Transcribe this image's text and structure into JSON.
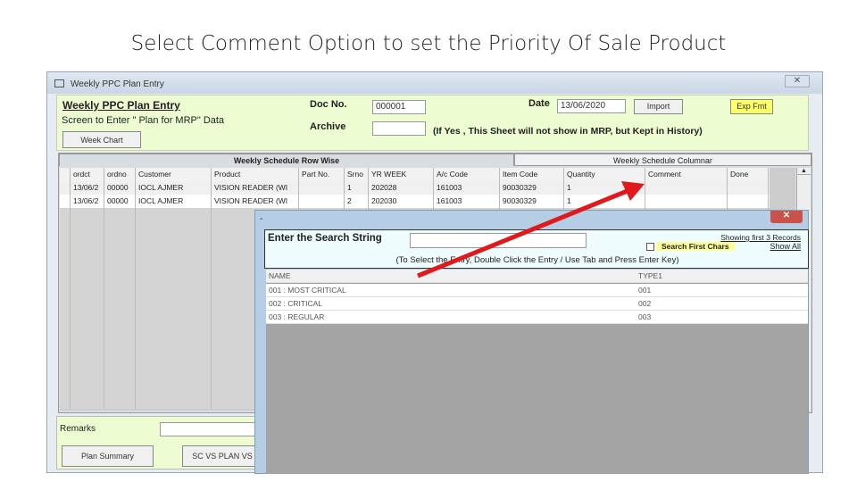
{
  "slide_title": "Select Comment Option to set the Priority Of Sale Product",
  "window": {
    "title": "Weekly PPC Plan Entry",
    "close": "✕"
  },
  "header": {
    "heading": "Weekly PPC Plan Entry",
    "subtitle": "Screen to Enter \" Plan for MRP\" Data",
    "week_chart": "Week Chart",
    "doc_no_label": "Doc No.",
    "doc_no": "000001",
    "archive_label": "Archive",
    "archive_note": "(If Yes , This Sheet will not show in MRP, but Kept in History)",
    "date_label": "Date",
    "date": "13/06/2020",
    "import": "Import",
    "exp_fmt": "Exp Fmt"
  },
  "tabs": [
    "Weekly Schedule Row Wise",
    "Weekly Schedule Columnar"
  ],
  "grid": {
    "columns": [
      "",
      "ordct",
      "ordno",
      "Customer",
      "Product",
      "Part No.",
      "Srno",
      "YR WEEK",
      "A/c Code",
      "Item Code",
      "Quantity",
      "Comment",
      "Done"
    ],
    "rows": [
      [
        "",
        "13/06/2",
        "00000",
        "IOCL AJMER",
        "VISION READER (WI",
        "",
        "1",
        "202028",
        "161003",
        "90030329",
        "1",
        "",
        ""
      ],
      [
        "",
        "13/06/2",
        "00000",
        "IOCL AJMER",
        "VISION READER (WI",
        "",
        "2",
        "202030",
        "161003",
        "90030329",
        "1",
        "",
        ""
      ]
    ]
  },
  "footer": {
    "remarks_label": "Remarks",
    "plan_summary": "Plan Summary",
    "sc_vs_plan": "SC VS PLAN VS"
  },
  "popup": {
    "title": "-",
    "close": "✕",
    "search_label": "Enter the Search String",
    "search_value": "",
    "showing": "Showing first 3 Records",
    "search_first_chars": "Search First Chars",
    "show_all": "Show All",
    "hint": "(To Select the Entry, Double Click the Entry / Use Tab and Press Enter Key)",
    "columns": [
      "NAME",
      "TYPE1"
    ],
    "rows": [
      [
        "001 : MOST CRITICAL",
        "001"
      ],
      [
        "002 : CRITICAL",
        "002"
      ],
      [
        "003 : REGULAR",
        "003"
      ]
    ]
  },
  "colors": {
    "arrow": "#e0191c",
    "panel": "#eefcd2",
    "exp_button": "#ffff66"
  }
}
